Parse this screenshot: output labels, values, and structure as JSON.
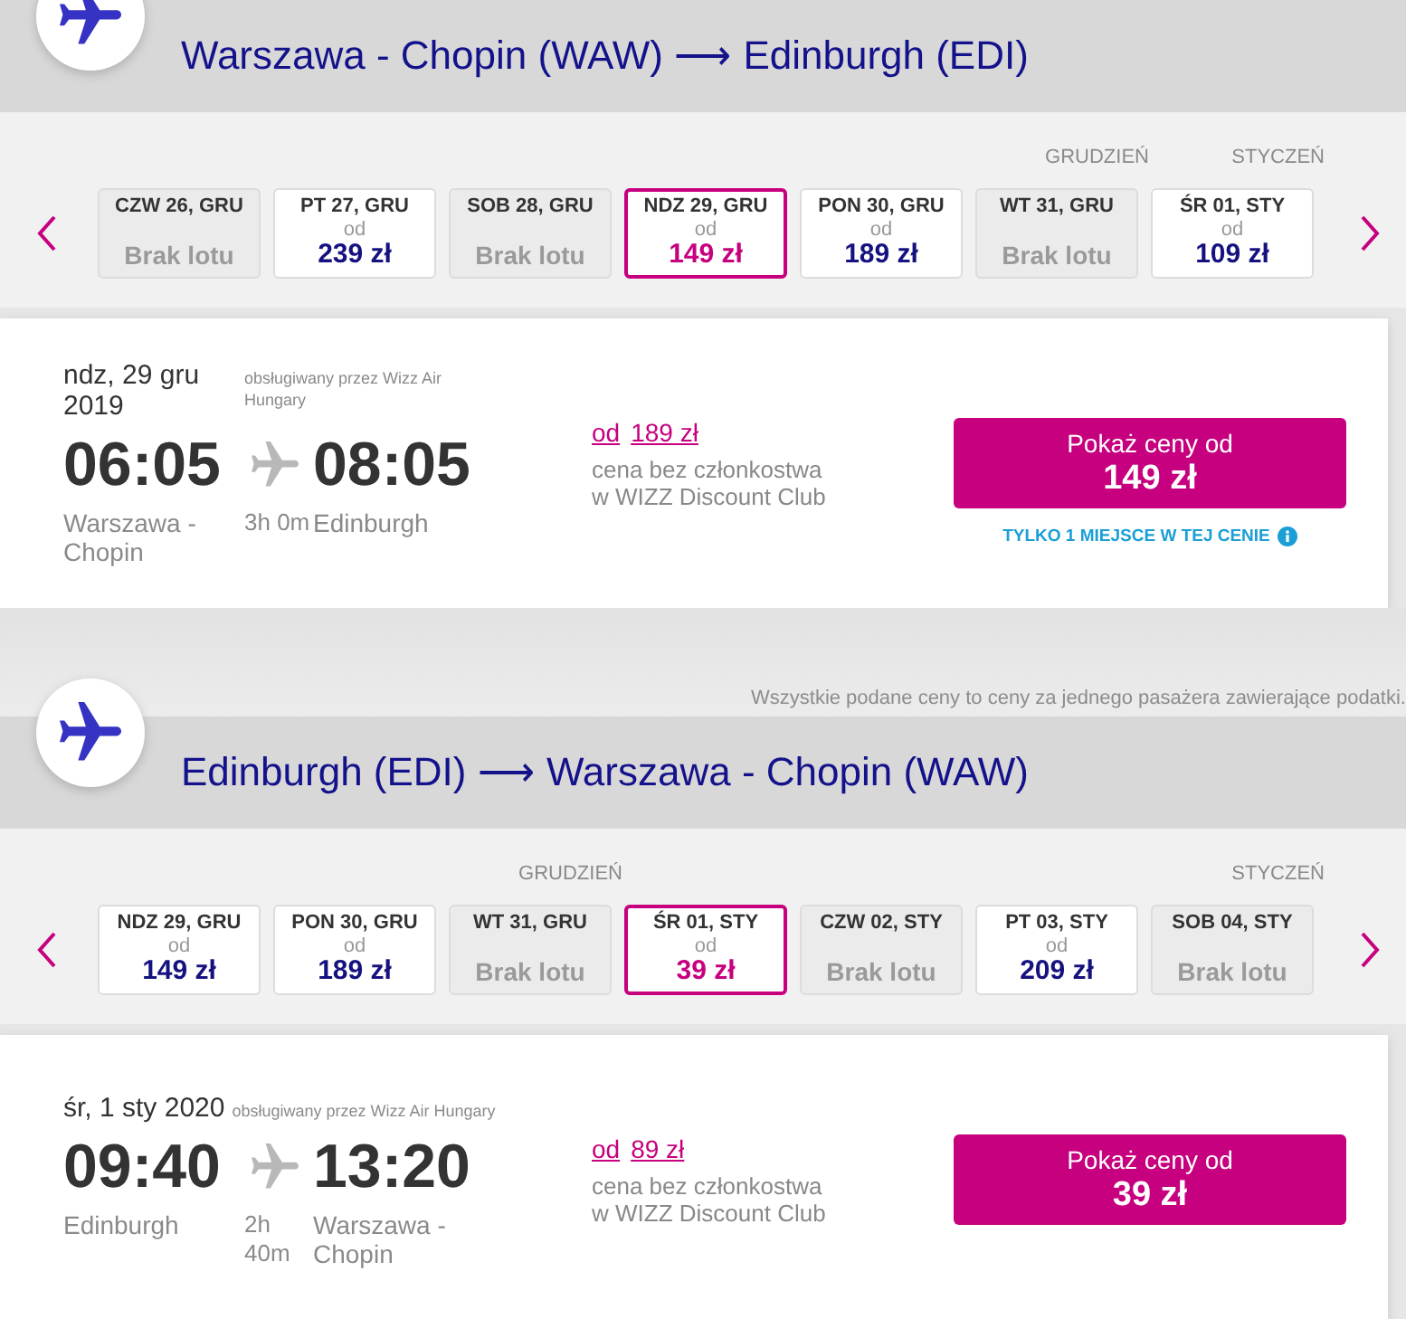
{
  "legs": [
    {
      "route_title": "Warszawa - Chopin (WAW) ⟶ Edinburgh (EDI)",
      "dates": [
        {
          "label": "CZW 26, GRU",
          "available": false,
          "status": "Brak lotu",
          "selected": false
        },
        {
          "label": "PT 27, GRU",
          "available": true,
          "from": "od",
          "price": "239 zł",
          "selected": false
        },
        {
          "label": "SOB 28, GRU",
          "available": false,
          "status": "Brak lotu",
          "selected": false
        },
        {
          "label": "NDZ 29, GRU",
          "available": true,
          "from": "od",
          "price": "149 zł",
          "selected": true
        },
        {
          "label": "PON 30, GRU",
          "available": true,
          "from": "od",
          "price": "189 zł",
          "selected": false
        },
        {
          "label": "WT 31, GRU",
          "month": "GRUDZIEŃ",
          "available": false,
          "status": "Brak lotu",
          "selected": false
        },
        {
          "label": "ŚR 01, STY",
          "month": "STYCZEŃ",
          "available": true,
          "from": "od",
          "price": "109 zł",
          "selected": false
        }
      ],
      "flight": {
        "date": "ndz, 29 gru 2019",
        "operator": "obsługiwany przez Wizz Air Hungary",
        "departure_time": "06:05",
        "arrival_time": "08:05",
        "departure_airport": "Warszawa - Chopin",
        "duration": "3h 0m",
        "arrival_airport": "Edinburgh",
        "non_member_price": {
          "prefix": "od",
          "price": "189 zł",
          "note": "cena bez członkostwa w WIZZ Discount Club"
        },
        "price_button": {
          "label": "Pokaż ceny od",
          "price": "149 zł"
        },
        "seats_notice": "TYLKO 1 MIEJSCE W TEJ CENIE"
      },
      "footer_note": "Wszystkie podane ceny to ceny za jednego pasażera zawierające podatki."
    },
    {
      "route_title": "Edinburgh (EDI) ⟶ Warszawa - Chopin (WAW)",
      "dates": [
        {
          "label": "NDZ 29, GRU",
          "available": true,
          "from": "od",
          "price": "149 zł",
          "selected": false
        },
        {
          "label": "PON 30, GRU",
          "available": true,
          "from": "od",
          "price": "189 zł",
          "selected": false
        },
        {
          "label": "WT 31, GRU",
          "month": "GRUDZIEŃ",
          "available": false,
          "status": "Brak lotu",
          "selected": false
        },
        {
          "label": "ŚR 01, STY",
          "available": true,
          "from": "od",
          "price": "39 zł",
          "selected": true
        },
        {
          "label": "CZW 02, STY",
          "available": false,
          "status": "Brak lotu",
          "selected": false
        },
        {
          "label": "PT 03, STY",
          "available": true,
          "from": "od",
          "price": "209 zł",
          "selected": false
        },
        {
          "label": "SOB 04, STY",
          "month": "STYCZEŃ",
          "available": false,
          "status": "Brak lotu",
          "selected": false
        }
      ],
      "flight": {
        "date": "śr, 1 sty 2020",
        "operator": "obsługiwany przez Wizz Air Hungary",
        "departure_time": "09:40",
        "arrival_time": "13:20",
        "departure_airport": "Edinburgh",
        "duration": "2h 40m",
        "arrival_airport": "Warszawa - Chopin",
        "non_member_price": {
          "prefix": "od",
          "price": "89 zł",
          "note": "cena bez członkostwa w WIZZ Discount Club"
        },
        "price_button": {
          "label": "Pokaż ceny od",
          "price": "39 zł"
        }
      }
    }
  ]
}
